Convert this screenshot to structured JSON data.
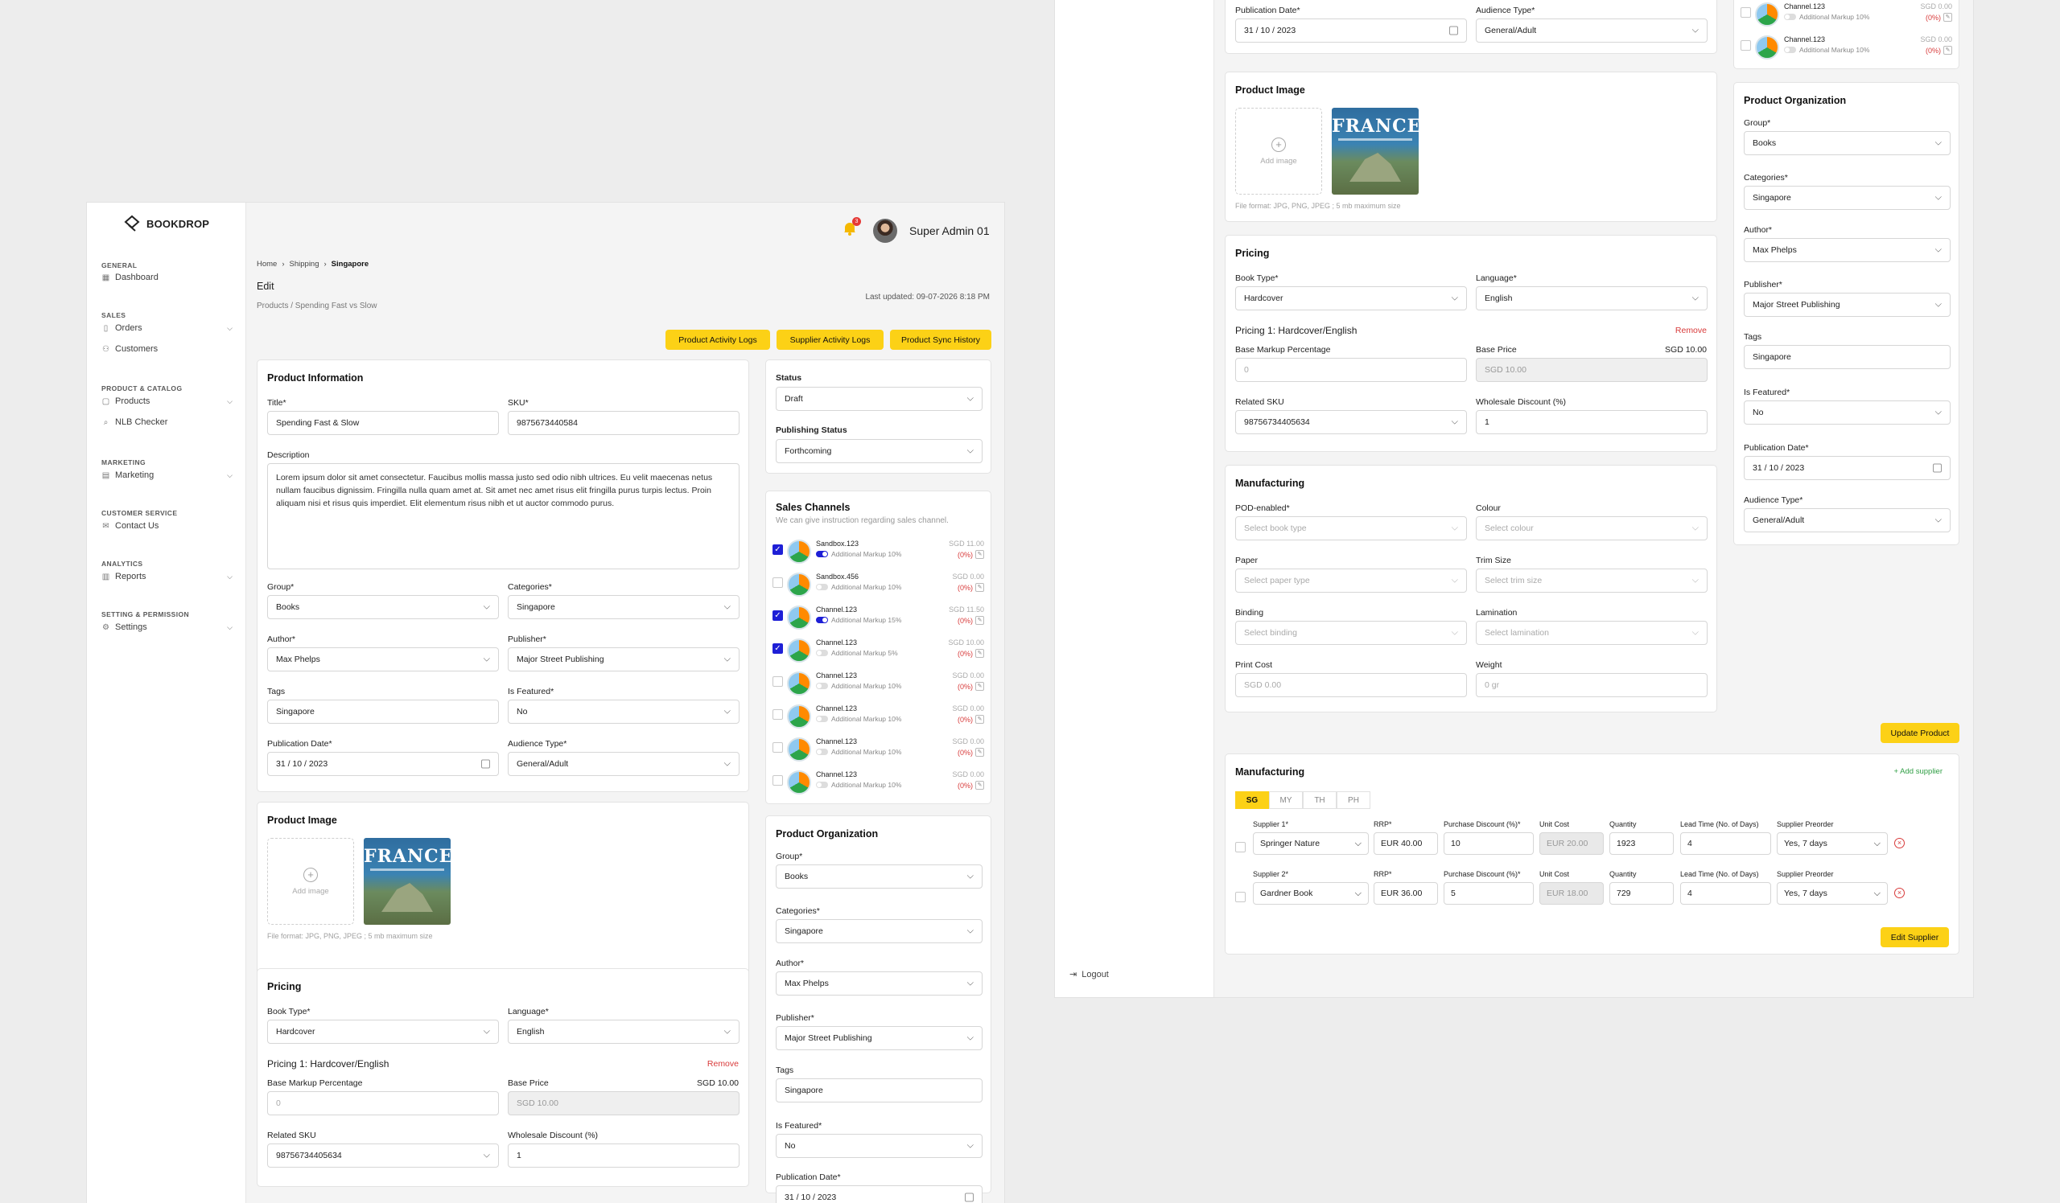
{
  "brand": {
    "name": "BOOKDROP"
  },
  "user": {
    "name": "Super Admin 01",
    "notif_count": "3"
  },
  "nav": {
    "general": "GENERAL",
    "dashboard": "Dashboard",
    "sales": "SALES",
    "orders": "Orders",
    "customers": "Customers",
    "catalog": "PRODUCT & CATALOG",
    "products": "Products",
    "nlb": "NLB Checker",
    "marketing_sec": "MARKETING",
    "marketing": "Marketing",
    "cs": "CUSTOMER SERVICE",
    "contact": "Contact Us",
    "analytics": "ANALYTICS",
    "reports": "Reports",
    "settings_sec": "SETTING & PERMISSION",
    "settings": "Settings",
    "logout": "Logout"
  },
  "breadcrumb": {
    "home": "Home",
    "shipping": "Shipping",
    "current": "Singapore"
  },
  "page": {
    "title": "Edit",
    "subtitle": "Products / Spending Fast vs Slow",
    "last_updated": "Last updated: 09-07-2026 8:18 PM"
  },
  "actions": {
    "product_logs": "Product Activity Logs",
    "supplier_logs": "Supplier Activity Logs",
    "sync_history": "Product Sync History",
    "update": "Update Product",
    "edit_supplier": "Edit Supplier",
    "add_supplier": "+ Add supplier"
  },
  "info": {
    "heading": "Product Information",
    "title_label": "Title*",
    "title_value": "Spending Fast & Slow",
    "sku_label": "SKU*",
    "sku_value": "9875673440584",
    "desc_label": "Description",
    "desc_value": "Lorem ipsum dolor sit amet consectetur. Faucibus mollis massa justo sed odio nibh ultrices. Eu velit maecenas netus nullam faucibus dignissim. Fringilla nulla quam amet at. Sit amet nec amet risus elit fringilla purus turpis lectus. Proin aliquam nisi et risus quis imperdiet. Elit elementum risus nibh et ut auctor commodo purus.",
    "group_label": "Group*",
    "group_value": "Books",
    "cat_label": "Categories*",
    "cat_value": "Singapore",
    "author_label": "Author*",
    "author_value": "Max Phelps",
    "pub_label": "Publisher*",
    "pub_value": "Major Street Publishing",
    "tags_label": "Tags",
    "tags_value": "Singapore",
    "feat_label": "Is Featured*",
    "feat_value": "No",
    "date_label": "Publication Date*",
    "date_value": "31 / 10 / 2023",
    "aud_label": "Audience Type*",
    "aud_value": "General/Adult"
  },
  "status": {
    "label": "Status",
    "value": "Draft",
    "pub_label": "Publishing Status",
    "pub_value": "Forthcoming"
  },
  "channels": {
    "heading": "Sales Channels",
    "hint": "We can give instruction regarding sales channel.",
    "items": [
      {
        "name": "Sandbox.123",
        "markup": "Additional Markup 10%",
        "price": "SGD 11.00",
        "pct": "(0%)"
      },
      {
        "name": "Sandbox.456",
        "markup": "Additional Markup 10%",
        "price": "SGD 0.00",
        "pct": "(0%)"
      },
      {
        "name": "Channel.123",
        "markup": "Additional Markup 15%",
        "price": "SGD 11.50",
        "pct": "(0%)"
      },
      {
        "name": "Channel.123",
        "markup": "Additional Markup 5%",
        "price": "SGD 10.00",
        "pct": "(0%)"
      },
      {
        "name": "Channel.123",
        "markup": "Additional Markup 10%",
        "price": "SGD 0.00",
        "pct": "(0%)"
      },
      {
        "name": "Channel.123",
        "markup": "Additional Markup 10%",
        "price": "SGD 0.00",
        "pct": "(0%)"
      },
      {
        "name": "Channel.123",
        "markup": "Additional Markup 10%",
        "price": "SGD 0.00",
        "pct": "(0%)"
      },
      {
        "name": "Channel.123",
        "markup": "Additional Markup 10%",
        "price": "SGD 0.00",
        "pct": "(0%)"
      }
    ]
  },
  "org": {
    "heading": "Product Organization"
  },
  "image": {
    "heading": "Product Image",
    "add": "Add image",
    "cover_title": "FRANCE",
    "format": "File format: JPG, PNG, JPEG ; 5 mb maximum size"
  },
  "pricing": {
    "heading": "Pricing",
    "book_type_label": "Book Type*",
    "book_type": "Hardcover",
    "lang_label": "Language*",
    "lang": "English",
    "sub": "Pricing 1: Hardcover/English",
    "remove": "Remove",
    "markup_label": "Base Markup Percentage",
    "markup_ph": "0",
    "base_label": "Base Price",
    "base_right": "SGD 10.00",
    "base_value": "SGD 10.00",
    "rsku_label": "Related SKU",
    "rsku": "98756734405634",
    "wd_label": "Wholesale Discount (%)",
    "wd": "1"
  },
  "manufacturing": {
    "heading": "Manufacturing",
    "pod_label": "POD-enabled*",
    "pod_ph": "Select book type",
    "colour_label": "Colour",
    "colour_ph": "Select colour",
    "paper_label": "Paper",
    "paper_ph": "Select paper type",
    "trim_label": "Trim Size",
    "trim_ph": "Select trim size",
    "binding_label": "Binding",
    "binding_ph": "Select binding",
    "lam_label": "Lamination",
    "lam_ph": "Select lamination",
    "print_label": "Print Cost",
    "print_ph": "SGD 0.00",
    "weight_label": "Weight",
    "weight_ph": "0 gr"
  },
  "suppliers": {
    "heading": "Manufacturing",
    "tabs": [
      "SG",
      "MY",
      "TH",
      "PH"
    ],
    "cols": {
      "rrp": "RRP*",
      "pd": "Purchase Discount (%)*",
      "uc": "Unit Cost",
      "qty": "Quantity",
      "lead": "Lead Time (No. of Days)",
      "pre": "Supplier Preorder"
    },
    "rows": [
      {
        "label": "Supplier 1*",
        "name": "Springer Nature",
        "rrp": "EUR 40.00",
        "pd": "10",
        "uc": "EUR 20.00",
        "qty": "1923",
        "lead": "4",
        "pre": "Yes, 7 days"
      },
      {
        "label": "Supplier 2*",
        "name": "Gardner Book",
        "rrp": "EUR 36.00",
        "pd": "5",
        "uc": "EUR 18.00",
        "qty": "729",
        "lead": "4",
        "pre": "Yes, 7 days"
      }
    ]
  }
}
